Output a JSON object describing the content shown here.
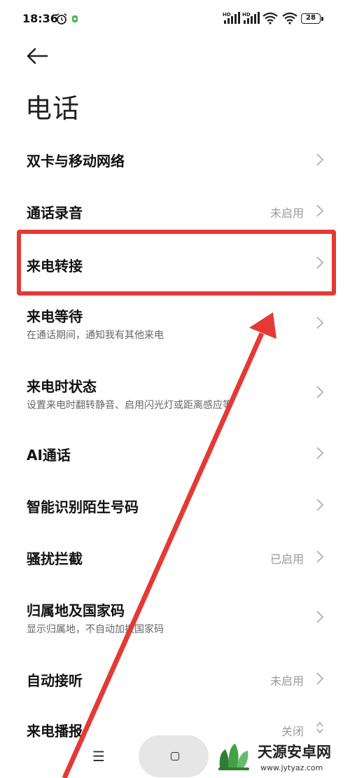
{
  "status_bar": {
    "time": "18:36",
    "battery": "28",
    "network_1": "HD",
    "network_2": "HD"
  },
  "header": {
    "title": "电话"
  },
  "settings": [
    {
      "title": "双卡与移动网络",
      "subtitle": "",
      "value": ""
    },
    {
      "title": "通话录音",
      "subtitle": "",
      "value": "未启用"
    },
    {
      "title": "来电转接",
      "subtitle": "",
      "value": ""
    },
    {
      "title": "来电等待",
      "subtitle": "在通话期间，通知我有其他来电",
      "value": ""
    },
    {
      "title": "来电时状态",
      "subtitle": "设置来电时翻转静音、启用闪光灯或距离感应等",
      "value": ""
    },
    {
      "title": "AI通话",
      "subtitle": "",
      "value": ""
    },
    {
      "title": "智能识别陌生号码",
      "subtitle": "",
      "value": ""
    },
    {
      "title": "骚扰拦截",
      "subtitle": "",
      "value": "已启用"
    },
    {
      "title": "归属地及国家码",
      "subtitle": "显示归属地，不自动加拨国家码",
      "value": ""
    },
    {
      "title": "自动接听",
      "subtitle": "",
      "value": "未启用"
    },
    {
      "title": "来电播报",
      "subtitle": "",
      "value": "关闭"
    }
  ],
  "annotation": {
    "color": "#e53935"
  },
  "nav": {
    "menu_glyph": "☰"
  },
  "watermark": {
    "name": "天源安卓网",
    "url": "www.jytyaz.com"
  }
}
